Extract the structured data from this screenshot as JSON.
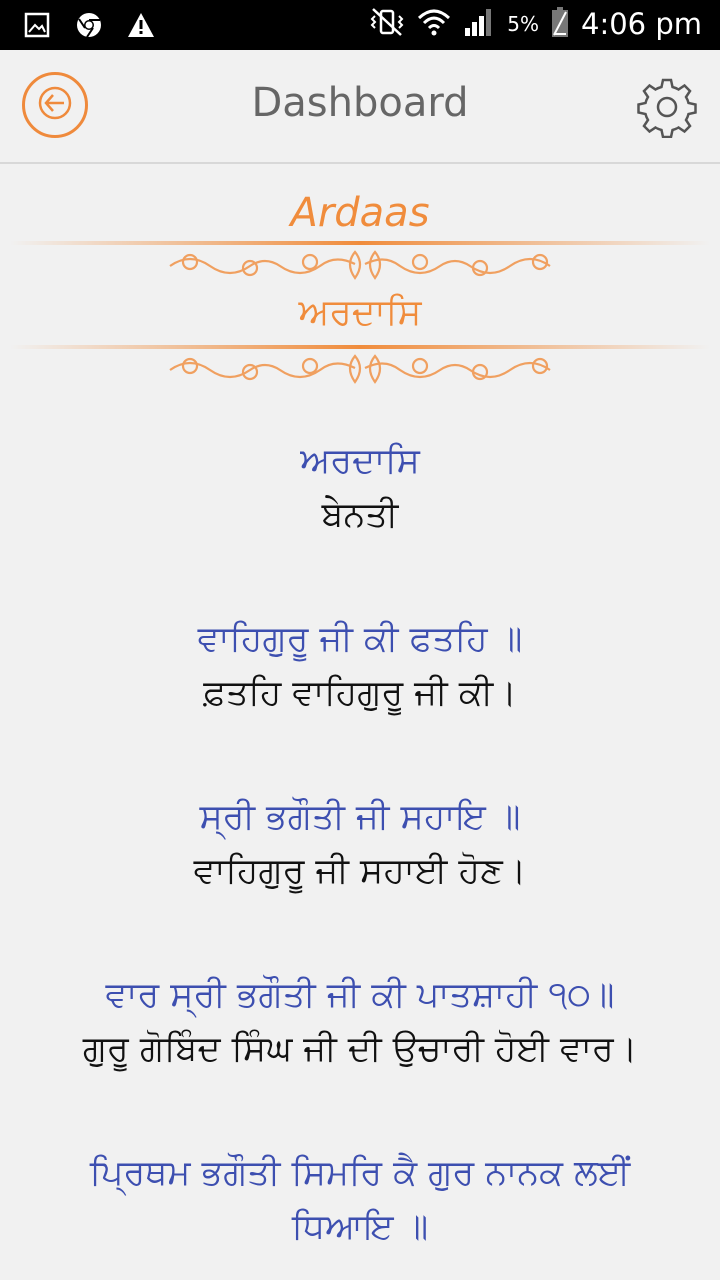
{
  "status_bar": {
    "battery": "5%",
    "time": "4:06 pm",
    "left_icons": [
      "image-icon",
      "chrome-icon",
      "warning-icon"
    ],
    "right_icons": [
      "vibrate-mute-icon",
      "wifi-icon",
      "signal-icon",
      "battery-icon"
    ]
  },
  "appbar": {
    "title": "Dashboard",
    "back_icon": "arrow-left-icon",
    "settings_icon": "gear-icon"
  },
  "header": {
    "english": "Ardaas",
    "punjabi": "ਅਰਦਾਸਿ"
  },
  "colors": {
    "accent": "#f08c3c",
    "gurmukhi_text": "#3d4fb0",
    "translation_text": "#111111",
    "background": "#f1f1f1"
  },
  "verses": [
    {
      "gurmukhi": "ਅਰਦਾਸਿ",
      "translation": "ਬੇਨਤੀ"
    },
    {
      "gurmukhi": "ਵਾਹਿਗੁਰੂ ਜੀ ਕੀ ਫਤਹਿ ॥",
      "translation": "ਫ਼ਤਹਿ ਵਾਹਿਗੁਰੂ ਜੀ ਕੀ।"
    },
    {
      "gurmukhi": "ਸ੍ਰੀ ਭਗੌਤੀ ਜੀ ਸਹਾਇ ॥",
      "translation": "ਵਾਹਿਗੁਰੂ ਜੀ ਸਹਾਈ ਹੋਣ।"
    },
    {
      "gurmukhi": "ਵਾਰ ਸ੍ਰੀ ਭਗੌਤੀ ਜੀ ਕੀ ਪਾਤਸ਼ਾਹੀ ੧੦॥",
      "translation": "ਗੁਰੂ ਗੋਬਿੰਦ ਸਿੰਘ ਜੀ ਦੀ ਉਚਾਰੀ ਹੋਈ ਵਾਰ।"
    },
    {
      "gurmukhi": "ਪ੍ਰਿਥਮ ਭਗੌਤੀ ਸਿਮਰਿ ਕੈ ਗੁਰ ਨਾਨਕ ਲਈਂ ਧਿਆਇ ॥",
      "translation": ""
    }
  ]
}
